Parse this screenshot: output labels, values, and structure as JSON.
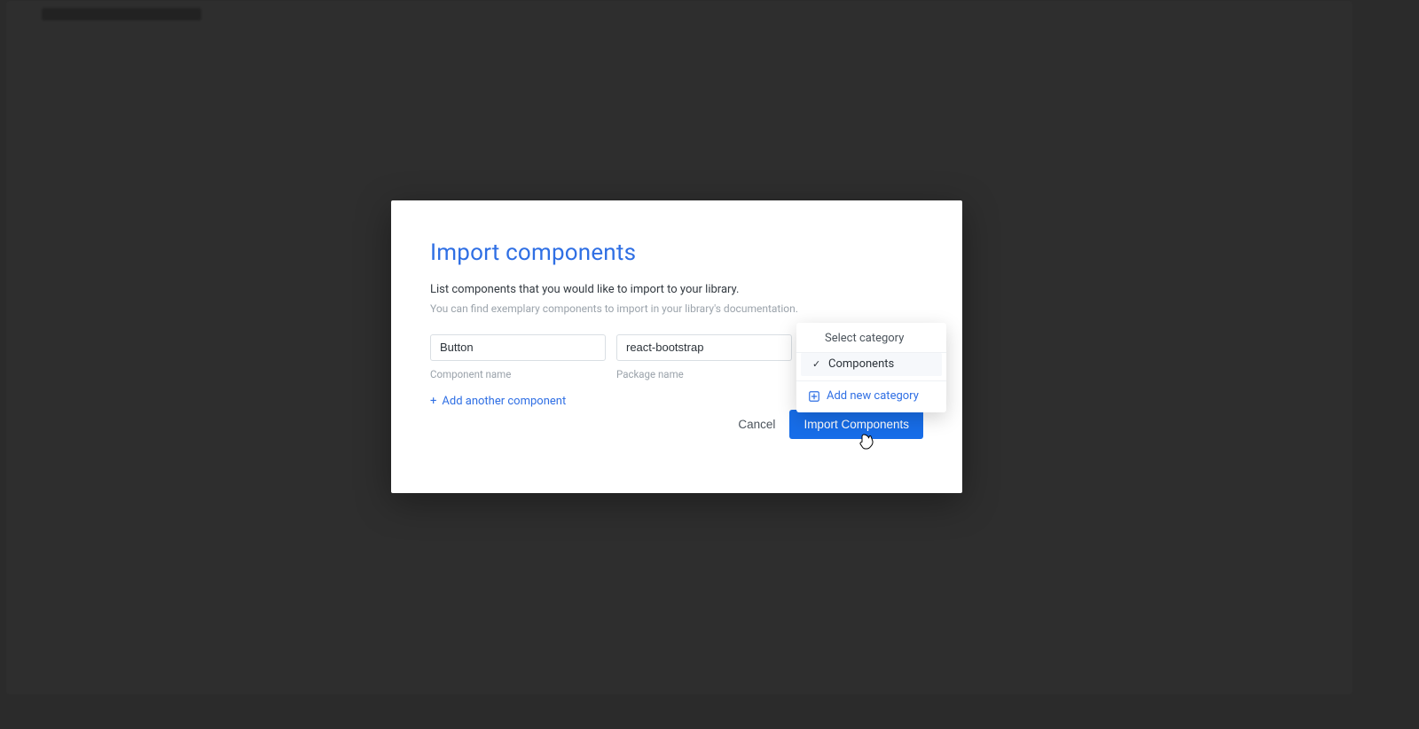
{
  "modal": {
    "title": "Import components",
    "desc_primary": "List components that you would like to import to your library.",
    "desc_secondary": "You can find exemplary components to import in your library's documentation.",
    "fields": {
      "component": {
        "value": "Button",
        "label": "Component name"
      },
      "package": {
        "value": "react-bootstrap",
        "label": "Package name"
      },
      "category": {
        "label": "Select category"
      }
    },
    "add_another": "Add another component",
    "buttons": {
      "cancel": "Cancel",
      "primary": "Import Components"
    }
  },
  "dropdown": {
    "header": "Select category",
    "selected_item": "Components",
    "add_new": "Add new category"
  }
}
